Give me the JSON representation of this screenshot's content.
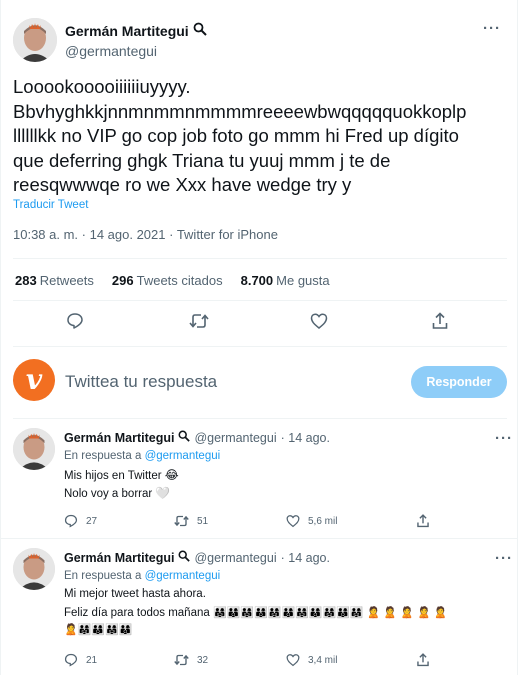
{
  "main": {
    "name": "Germán Martitegui",
    "handle": "@germantegui",
    "text_lines": [
      "Looookooooiiiiiiuyyyy.",
      "Bbvhyghkkjnnmnmmnmmmmreeeewbwqqqqquokkoplp",
      "llllllkk no VIP go cop job foto go mmm  hi Fred up dígito",
      "que deferring ghgk Triana tu yuuj mmm j  te de",
      "reesqwwwqe  ro we  Xxx have wedge  try y"
    ],
    "translate": "Traducir Tweet",
    "meta": "10:38 a. m. · 14 ago. 2021 · Twitter for iPhone",
    "stats": {
      "retweets_count": "283",
      "retweets_label": "Retweets",
      "quotes_count": "296",
      "quotes_label": "Tweets citados",
      "likes_count": "8.700",
      "likes_label": "Me gusta"
    }
  },
  "reply_box": {
    "placeholder": "Twittea tu respuesta",
    "button": "Responder",
    "logo_letter": "v"
  },
  "replies": [
    {
      "name": "Germán Martitegui",
      "handle": "@germantegui",
      "date": "· 14 ago.",
      "reply_prefix": "En respuesta a",
      "reply_to": "@germantegui",
      "line1": "Mis hijos en Twitter",
      "line1_emoji": "😂",
      "line2": "Nolo voy a borrar",
      "line2_emoji": "🤍",
      "replies": "27",
      "retweets": "51",
      "likes": "5,6 mil"
    },
    {
      "name": "Germán Martitegui",
      "handle": "@germantegui",
      "date": "· 14 ago.",
      "reply_prefix": "En respuesta a",
      "reply_to": "@germantegui",
      "line1": "Mi mejor tweet hasta ahora.",
      "line2": "Feliz día para todos mañana",
      "emoji_row1": "👨‍👩‍👧👨‍👩‍👦👨‍👩‍👧👨‍👩‍👦👨‍👩‍👧👨‍👩‍👦👨‍👩‍👧👨‍👩‍👦👨‍👩‍👧👨‍👩‍👦👨‍👩‍👧 🙎 🙎 🙎 🙎 🙎",
      "emoji_row2": "🙎👨‍👩‍👧👨‍👩‍👦👨‍👩‍👧👨‍👩‍👦",
      "replies": "21",
      "retweets": "32",
      "likes": "3,4 mil"
    }
  ],
  "icons": {
    "verified": "magnifier-icon",
    "reply": "reply-icon",
    "retweet": "retweet-icon",
    "like": "heart-icon",
    "share": "share-icon",
    "more": "more-icon"
  },
  "colors": {
    "link": "#1d9bf0",
    "muted": "#536471",
    "button": "#8ecdf8",
    "logo": "#f26f21"
  }
}
